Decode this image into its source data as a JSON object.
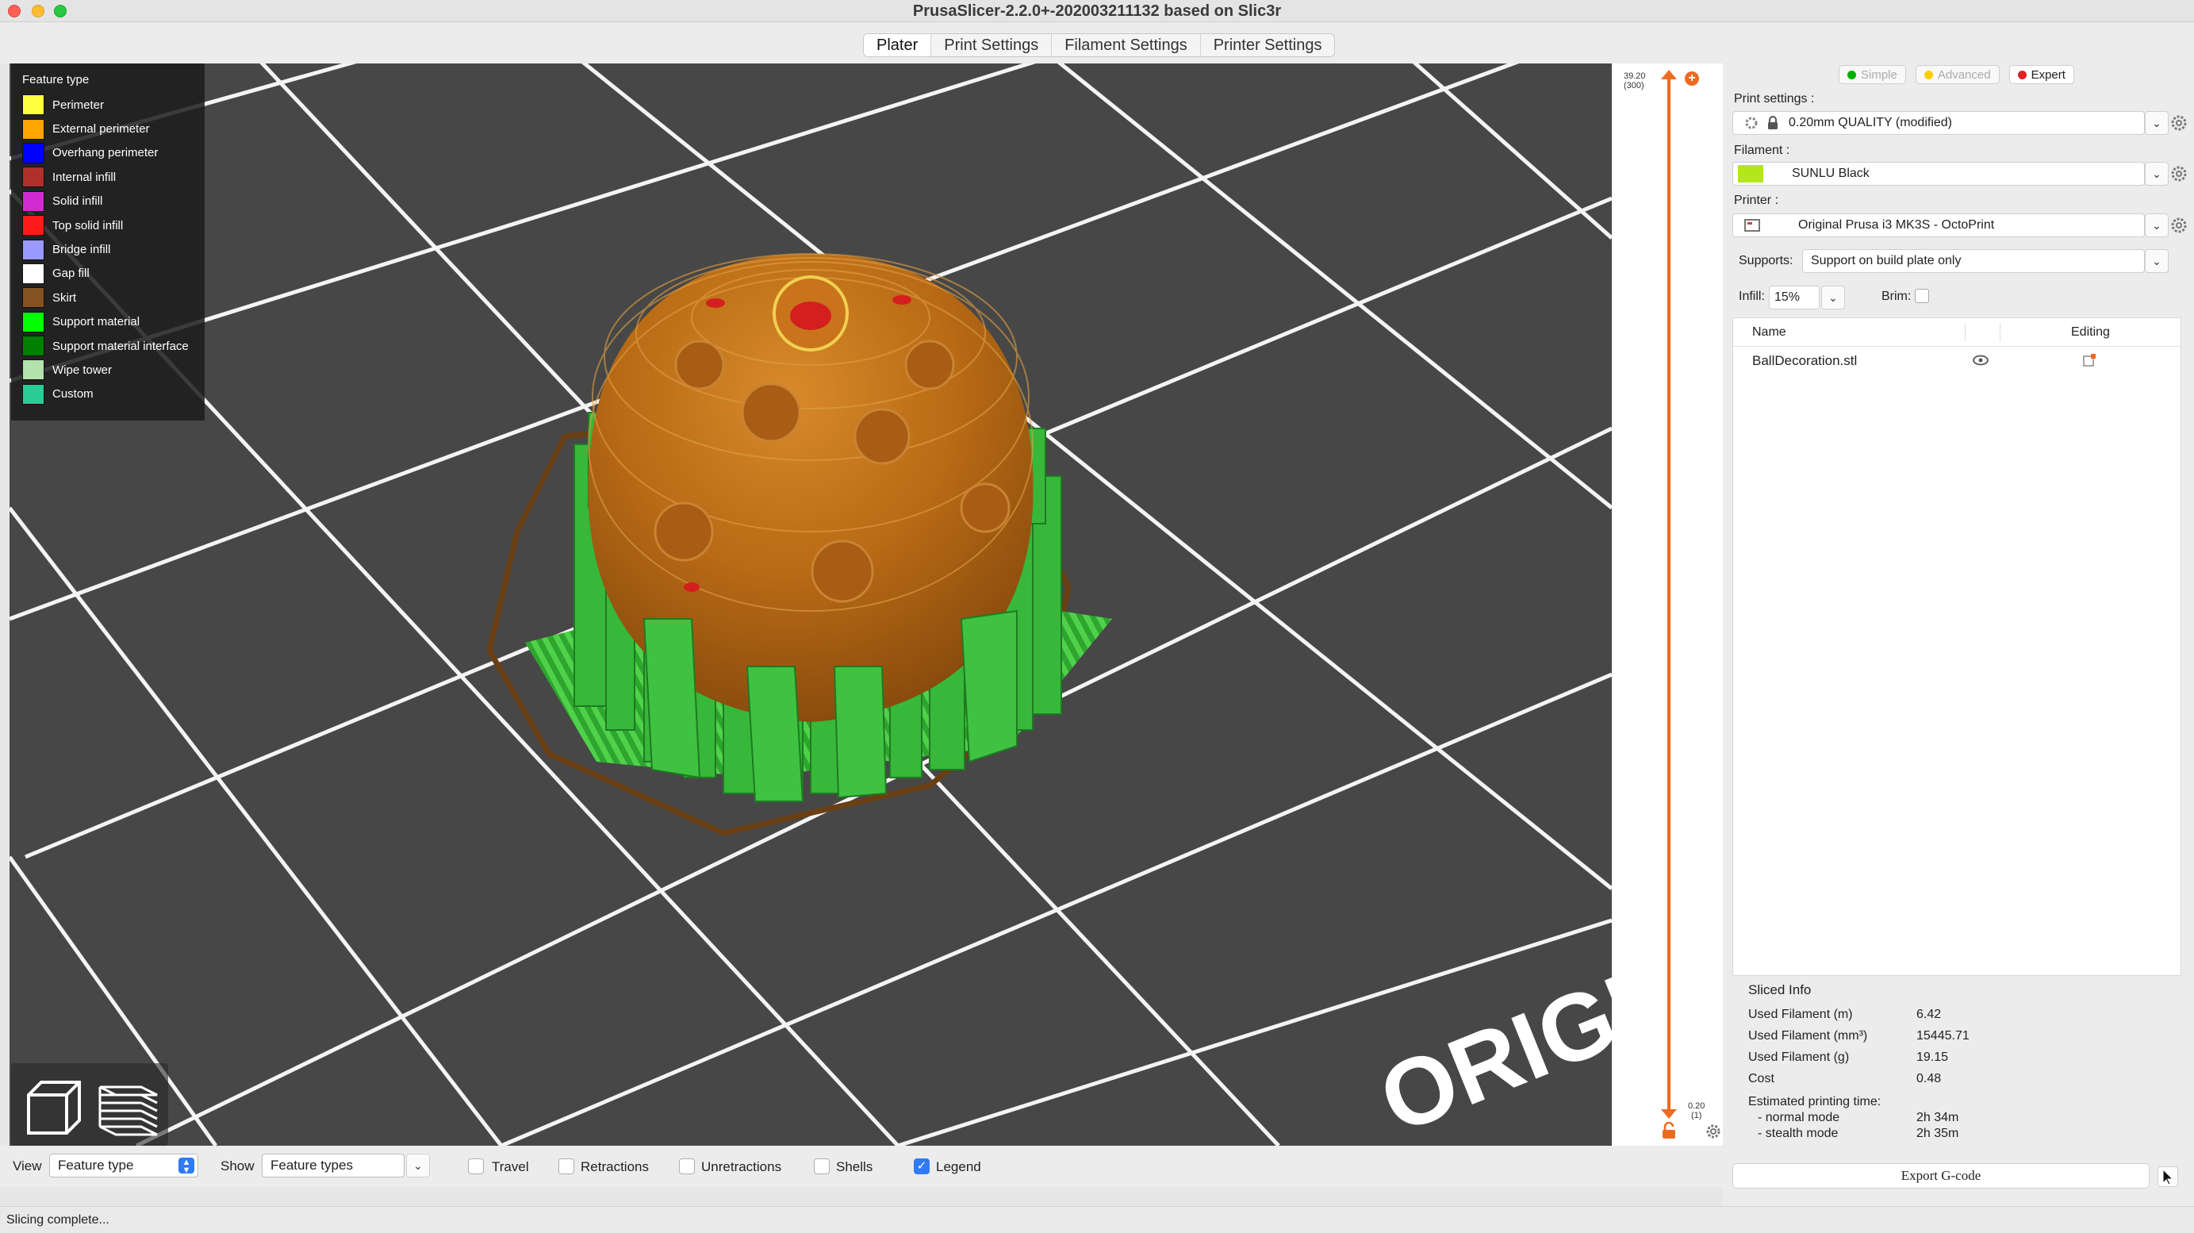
{
  "window": {
    "title": "PrusaSlicer-2.2.0+-202003211132 based on Slic3r"
  },
  "tabs": [
    {
      "label": "Plater",
      "active": true
    },
    {
      "label": "Print Settings",
      "active": false
    },
    {
      "label": "Filament Settings",
      "active": false
    },
    {
      "label": "Printer Settings",
      "active": false
    }
  ],
  "legend": {
    "title": "Feature type",
    "items": [
      {
        "label": "Perimeter",
        "color": "#ffff40"
      },
      {
        "label": "External perimeter",
        "color": "#ffa500"
      },
      {
        "label": "Overhang perimeter",
        "color": "#0000ff"
      },
      {
        "label": "Internal infill",
        "color": "#b03029"
      },
      {
        "label": "Solid infill",
        "color": "#d22ad2"
      },
      {
        "label": "Top solid infill",
        "color": "#ff1a1a"
      },
      {
        "label": "Bridge infill",
        "color": "#9999ff"
      },
      {
        "label": "Gap fill",
        "color": "#ffffff"
      },
      {
        "label": "Skirt",
        "color": "#845321"
      },
      {
        "label": "Support material",
        "color": "#00ff00"
      },
      {
        "label": "Support material interface",
        "color": "#008000"
      },
      {
        "label": "Wipe tower",
        "color": "#b3e3ab"
      },
      {
        "label": "Custom",
        "color": "#28cc94"
      }
    ]
  },
  "scene": {
    "bed_text": "ORIGI"
  },
  "layer_slider": {
    "top_height": "39.20",
    "top_layer": "(300)",
    "bottom_height": "0.20",
    "bottom_layer": "(1)"
  },
  "sidebar": {
    "modes": [
      {
        "label": "Simple",
        "color": "#00b000",
        "active": false
      },
      {
        "label": "Advanced",
        "color": "#fccc00",
        "active": false
      },
      {
        "label": "Expert",
        "color": "#e22222",
        "active": true
      }
    ],
    "print_settings": {
      "label": "Print settings :",
      "value": "0.20mm QUALITY (modified)"
    },
    "filament": {
      "label": "Filament :",
      "value": "SUNLU Black",
      "swatch_color": "#b5e61d"
    },
    "printer": {
      "label": "Printer :",
      "value": "Original Prusa i3 MK3S - OctoPrint"
    },
    "supports": {
      "label": "Supports:",
      "value": "Support on build plate only"
    },
    "infill": {
      "label": "Infill:",
      "value": "15%"
    },
    "brim": {
      "label": "Brim:"
    },
    "object_list": {
      "col_name": "Name",
      "col_editing": "Editing",
      "objects": [
        {
          "name": "BallDecoration.stl"
        }
      ]
    },
    "sliced_info": {
      "title": "Sliced Info",
      "rows": [
        {
          "label": "Used Filament (m)",
          "value": "6.42"
        },
        {
          "label": "Used Filament (mm³)",
          "value": "15445.71"
        },
        {
          "label": "Used Filament (g)",
          "value": "19.15"
        },
        {
          "label": "Cost",
          "value": "0.48"
        }
      ],
      "time_label": "Estimated printing time:",
      "normal_label": "- normal mode",
      "normal_value": "2h 34m",
      "stealth_label": "- stealth mode",
      "stealth_value": "2h 35m"
    },
    "export_label": "Export G-code"
  },
  "bottom_bar": {
    "view_label": "View",
    "view_value": "Feature type",
    "show_label": "Show",
    "show_value": "Feature types",
    "checks": [
      {
        "label": "Travel",
        "checked": false
      },
      {
        "label": "Retractions",
        "checked": false
      },
      {
        "label": "Unretractions",
        "checked": false
      },
      {
        "label": "Shells",
        "checked": false
      },
      {
        "label": "Legend",
        "checked": true
      }
    ]
  },
  "status": "Slicing complete..."
}
